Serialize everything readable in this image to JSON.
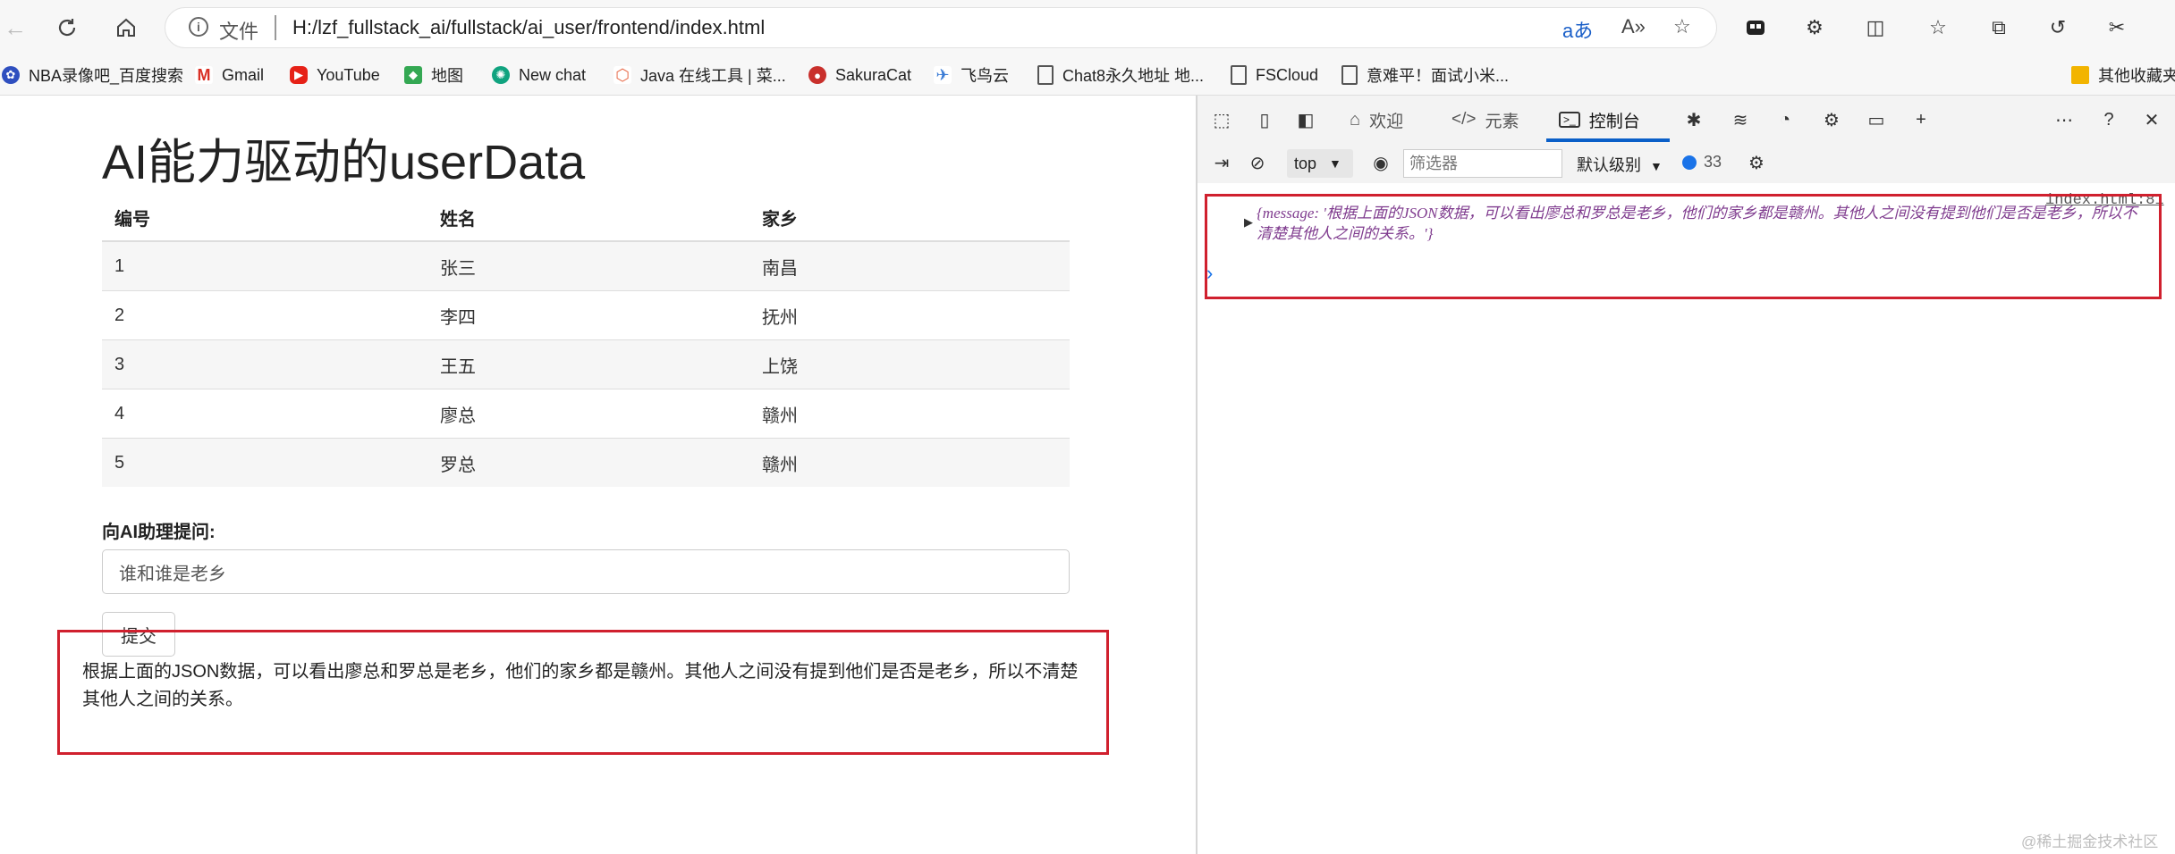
{
  "browser": {
    "file_label": "文件",
    "url": "H:/lzf_fullstack_ai/fullstack/ai_user/frontend/index.html",
    "bookmarks": [
      {
        "label": "NBA录像吧_百度搜索",
        "icon": "paw-icon",
        "color": "#2f4fbf"
      },
      {
        "label": "Gmail",
        "icon": "gmail-icon",
        "color": "#d93025"
      },
      {
        "label": "YouTube",
        "icon": "youtube-icon",
        "color": "#e62117"
      },
      {
        "label": "地图",
        "icon": "maps-icon",
        "color": "#34a853"
      },
      {
        "label": "New chat",
        "icon": "openai-icon",
        "color": "#10a37f"
      },
      {
        "label": "Java 在线工具 | 菜...",
        "icon": "runoob-icon",
        "color": "#e86b4a"
      },
      {
        "label": "SakuraCat",
        "icon": "cat-icon",
        "color": "#c9302c"
      },
      {
        "label": "飞鸟云",
        "icon": "bird-icon",
        "color": "#3a7bd5"
      },
      {
        "label": "Chat8永久地址 地...",
        "icon": "page-icon",
        "color": "#555555"
      },
      {
        "label": "FSCloud",
        "icon": "page-icon",
        "color": "#555555"
      },
      {
        "label": "意难平！面试小米...",
        "icon": "page-icon",
        "color": "#555555"
      }
    ],
    "other_bookmarks": "其他收藏夹"
  },
  "page": {
    "title": "AI能力驱动的userData",
    "table": {
      "headers": [
        "编号",
        "姓名",
        "家乡"
      ],
      "rows": [
        [
          "1",
          "张三",
          "南昌"
        ],
        [
          "2",
          "李四",
          "抚州"
        ],
        [
          "3",
          "王五",
          "上饶"
        ],
        [
          "4",
          "廖总",
          "赣州"
        ],
        [
          "5",
          "罗总",
          "赣州"
        ]
      ]
    },
    "question_label": "向AI助理提问:",
    "question_value": "谁和谁是老乡",
    "submit_label": "提交",
    "answer": "根据上面的JSON数据，可以看出廖总和罗总是老乡，他们的家乡都是赣州。其他人之间没有提到他们是否是老乡，所以不清楚其他人之间的关系。"
  },
  "devtools": {
    "tabs": {
      "welcome": "欢迎",
      "elements": "元素",
      "console": "控制台"
    },
    "context": "top",
    "filter_placeholder": "筛选器",
    "level": "默认级别",
    "message_count": "33",
    "source_link": "index.html:81",
    "log_message": "{message: '根据上面的JSON数据，可以看出廖总和罗总是老乡，他们的家乡都是赣州。其他人之间没有提到他们是否是老乡，所以不清楚其他人之间的关系。'}"
  },
  "watermark": "@稀土掘金技术社区",
  "colors": {
    "highlight": "#d0202e",
    "accent": "#0a5fc8"
  }
}
